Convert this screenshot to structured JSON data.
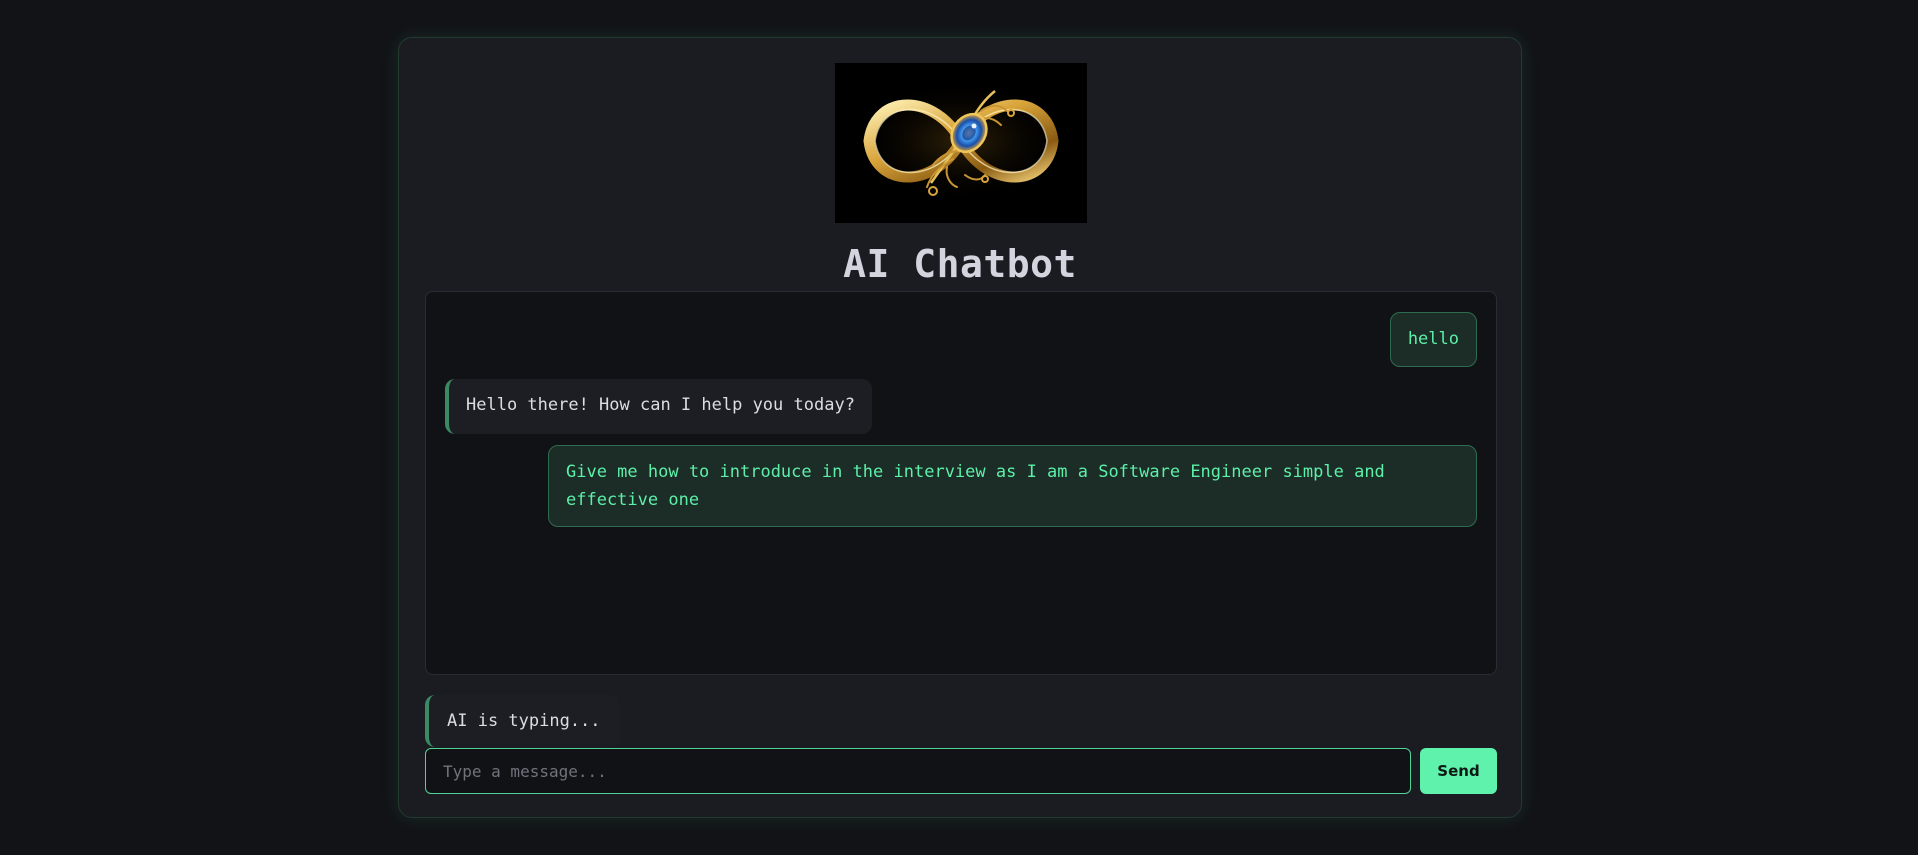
{
  "app": {
    "title": "AI Chatbot",
    "logo_icon": "golden-infinity-peacock-feather-logo"
  },
  "messages": [
    {
      "role": "user",
      "text": "hello"
    },
    {
      "role": "bot",
      "text": "Hello there! How can I help you today?"
    },
    {
      "role": "user",
      "text": "Give me how to introduce in the interview as I am a Software Engineer simple and effective one"
    }
  ],
  "status": {
    "typing_text": "AI is typing..."
  },
  "composer": {
    "placeholder": "Type a message...",
    "value": "",
    "send_label": "Send"
  },
  "colors": {
    "accent": "#5ff2ad",
    "user_text": "#5cf0a8",
    "background": "#121317",
    "card": "#1b1c21"
  }
}
